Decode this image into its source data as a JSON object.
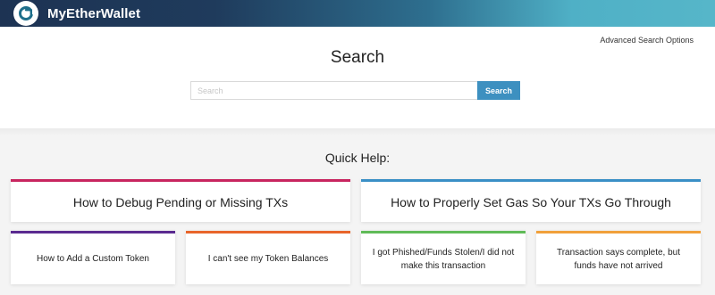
{
  "header": {
    "brand": "MyEtherWallet",
    "gradient": [
      "#1d3353",
      "#56b6c9"
    ]
  },
  "search": {
    "advanced_link": "Advanced Search Options",
    "title": "Search",
    "placeholder": "Search",
    "value": "",
    "button_label": "Search",
    "button_color": "#3d90c0"
  },
  "quick_help": {
    "title": "Quick Help:",
    "cards": [
      {
        "label": "How to Debug Pending or Missing TXs",
        "accent": "#c8255f"
      },
      {
        "label": "How to Properly Set Gas So Your TXs Go Through",
        "accent": "#3a8fc6"
      },
      {
        "label": "How to Add a Custom Token",
        "accent": "#5a2a90"
      },
      {
        "label": "I can't see my Token Balances",
        "accent": "#e8652a"
      },
      {
        "label": "I got Phished/Funds Stolen/I did not make this transaction",
        "accent": "#60bb58"
      },
      {
        "label": "Transaction says complete, but funds have not arrived",
        "accent": "#f1a03b"
      }
    ]
  }
}
